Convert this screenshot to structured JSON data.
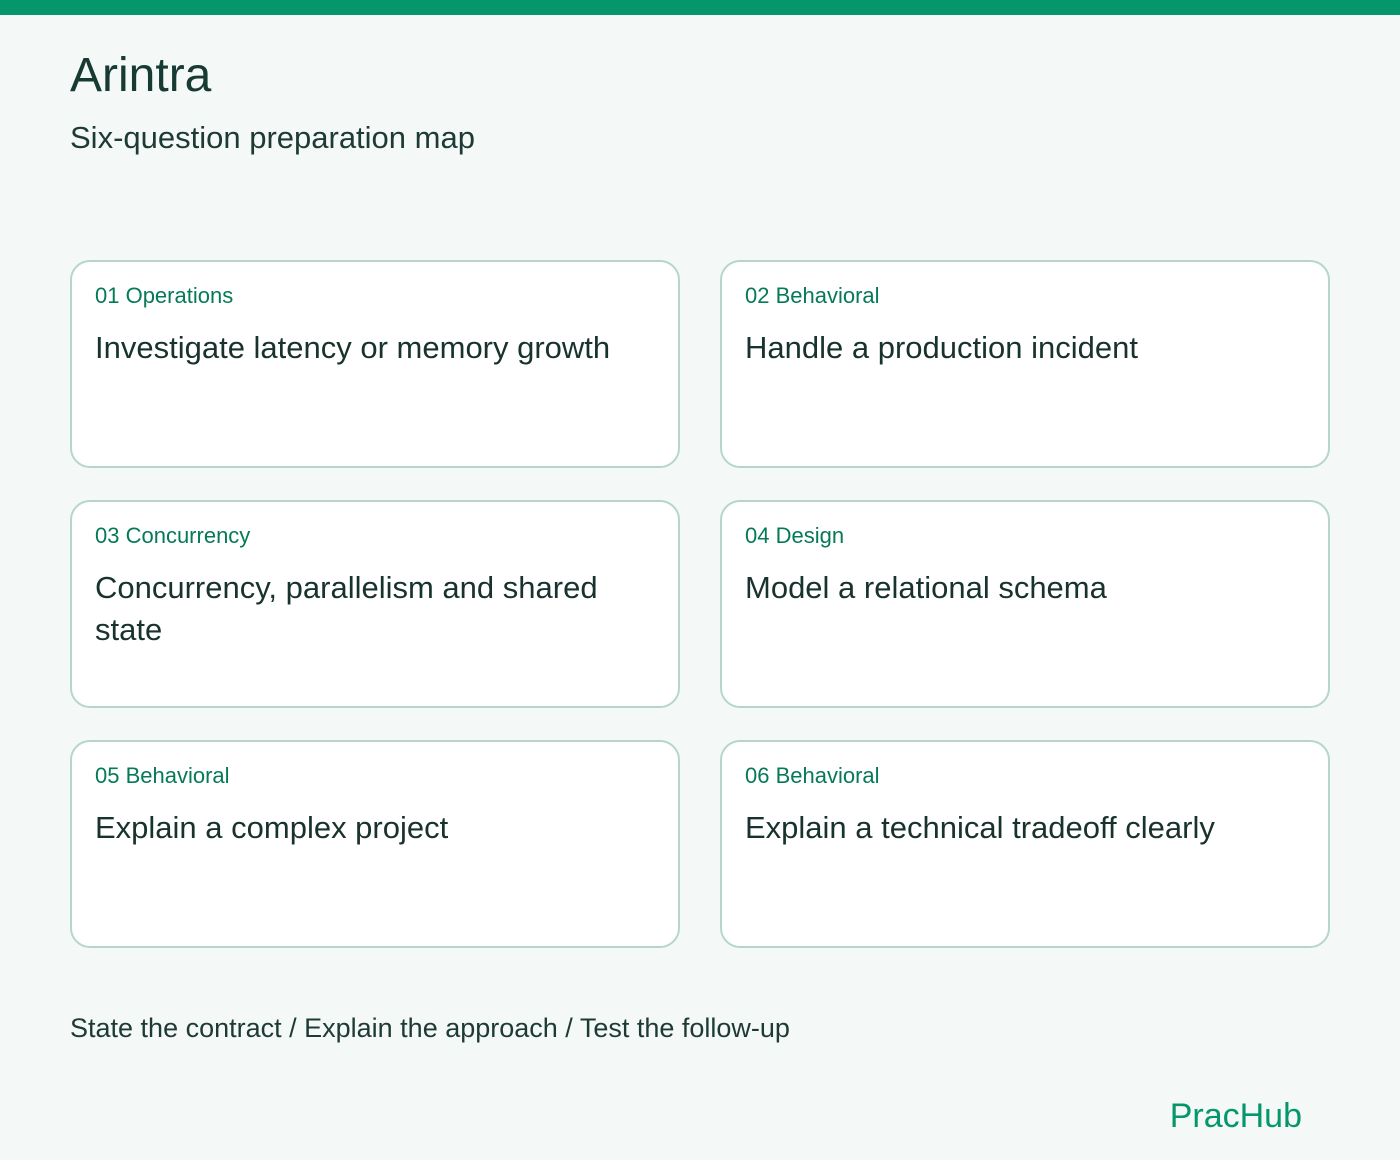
{
  "header": {
    "title": "Arintra",
    "subtitle": "Six-question preparation map"
  },
  "cards": [
    {
      "tag": "01 Operations",
      "title": "Investigate latency or memory growth"
    },
    {
      "tag": "02 Behavioral",
      "title": "Handle a production incident"
    },
    {
      "tag": "03 Concurrency",
      "title": "Concurrency, parallelism and shared state"
    },
    {
      "tag": "04 Design",
      "title": "Model a relational schema"
    },
    {
      "tag": "05 Behavioral",
      "title": "Explain a complex project"
    },
    {
      "tag": "06 Behavioral",
      "title": "Explain a technical tradeoff clearly"
    }
  ],
  "footer": {
    "steps": "State the contract / Explain the approach / Test the follow-up",
    "brand": "PracHub"
  },
  "colors": {
    "accent": "#05976b",
    "tag": "#067a57",
    "card_border": "#b6d6cd",
    "background": "#f4f8f7"
  }
}
